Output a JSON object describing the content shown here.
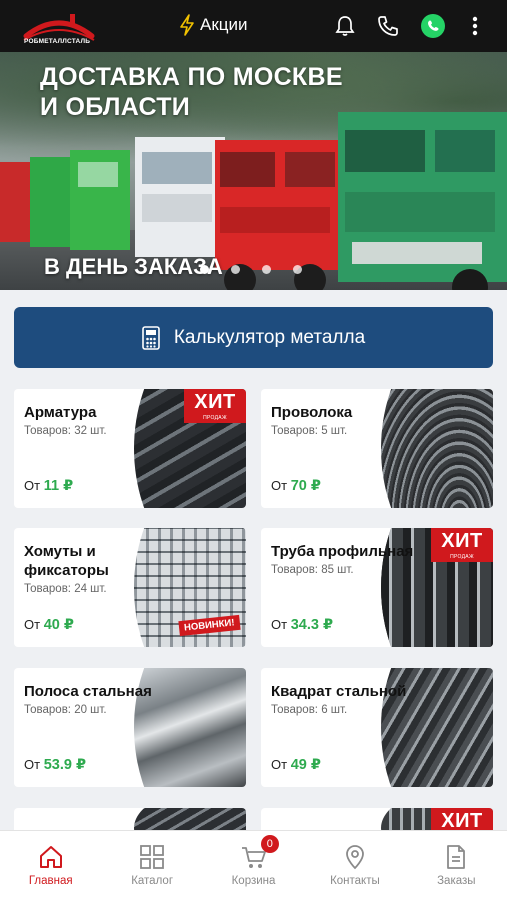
{
  "header": {
    "logo_text": "РОБМЕТАЛЛСТАЛЬ",
    "promo_label": "Акции",
    "icons": [
      "bell-icon",
      "phone-icon",
      "whatsapp-icon",
      "more-vertical-icon"
    ]
  },
  "banner": {
    "title_line1": "ДОСТАВКА ПО МОСКВЕ",
    "title_line2": "И ОБЛАСТИ",
    "subtitle": "В ДЕНЬ ЗАКАЗА",
    "slides_count": 4,
    "active_slide": 1
  },
  "calculator": {
    "label": "Калькулятор металла",
    "icon": "calculator-icon"
  },
  "products": [
    {
      "name": "Арматура",
      "count": "Товаров: 32 шт.",
      "price_prefix": "От",
      "price": "11",
      "currency": "₽",
      "badge": "ХИТ"
    },
    {
      "name": "Проволока",
      "count": "Товаров: 5 шт.",
      "price_prefix": "От",
      "price": "70",
      "currency": "₽",
      "badge": ""
    },
    {
      "name": "Хомуты и фиксаторы",
      "count": "Товаров: 24 шт.",
      "price_prefix": "От",
      "price": "40",
      "currency": "₽",
      "badge": "НОВИНКИ!"
    },
    {
      "name": "Труба профильная",
      "count": "Товаров: 85 шт.",
      "price_prefix": "От",
      "price": "34.3",
      "currency": "₽",
      "badge": "ХИТ"
    },
    {
      "name": "Полоса стальная",
      "count": "Товаров: 20 шт.",
      "price_prefix": "От",
      "price": "53.9",
      "currency": "₽",
      "badge": ""
    },
    {
      "name": "Квадрат  стальной",
      "count": "Товаров: 6 шт.",
      "price_prefix": "От",
      "price": "49",
      "currency": "₽",
      "badge": ""
    }
  ],
  "hit_badge": {
    "title": "ХИТ",
    "subtitle": "ПРОДАЖ"
  },
  "bottom_nav": [
    {
      "label": "Главная",
      "icon": "home-icon",
      "active": true
    },
    {
      "label": "Каталог",
      "icon": "grid-icon",
      "active": false
    },
    {
      "label": "Корзина",
      "icon": "cart-icon",
      "active": false,
      "badge": "0"
    },
    {
      "label": "Контакты",
      "icon": "location-pin-icon",
      "active": false
    },
    {
      "label": "Заказы",
      "icon": "document-icon",
      "active": false
    }
  ],
  "colors": {
    "accent": "#d0191d",
    "primary": "#1e4c7e",
    "price": "#2eaa4f",
    "topbar": "#141414"
  }
}
